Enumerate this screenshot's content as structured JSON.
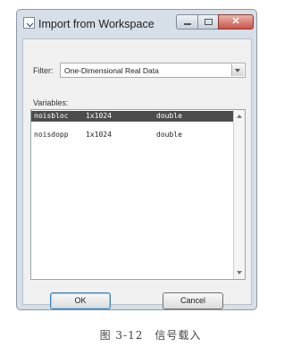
{
  "window": {
    "title": "Import from Workspace"
  },
  "filter": {
    "label": "Filter:",
    "value": "One-Dimensional Real Data"
  },
  "variables": {
    "label": "Variables:",
    "rows": [
      {
        "name": "noisbloc",
        "size": "1x1024",
        "class": "double",
        "selected": true
      },
      {
        "name": "noisdopp",
        "size": "1x1024",
        "class": "double",
        "selected": false
      }
    ]
  },
  "buttons": {
    "ok": "OK",
    "cancel": "Cancel"
  },
  "caption": "图 3-12　信号载入",
  "colors": {
    "selected_row": "#4d4d4d",
    "window_frame": "#d6dee8",
    "close_button": "#c9544a"
  }
}
